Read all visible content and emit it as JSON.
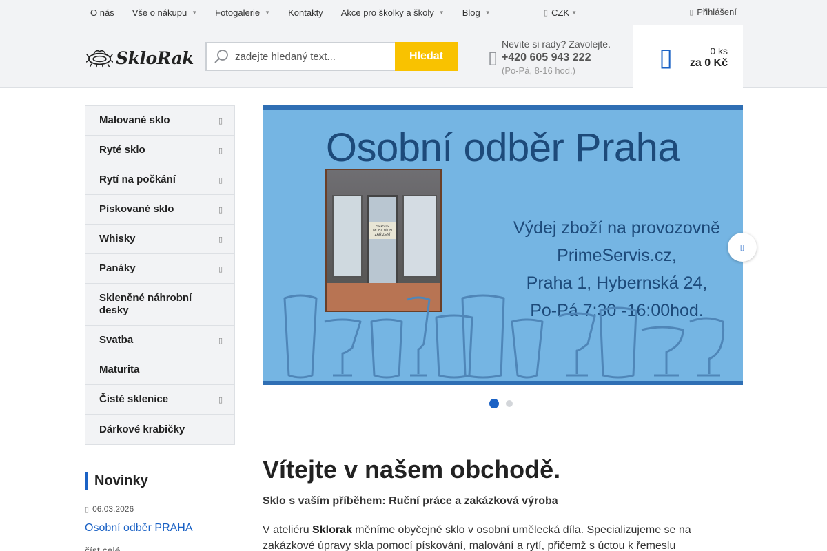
{
  "topnav": {
    "items": [
      {
        "label": "O nás",
        "has_dropdown": false
      },
      {
        "label": "Vše o nákupu",
        "has_dropdown": true
      },
      {
        "label": "Fotogalerie",
        "has_dropdown": true
      },
      {
        "label": "Kontakty",
        "has_dropdown": false
      },
      {
        "label": "Akce pro školky a školy",
        "has_dropdown": true
      },
      {
        "label": "Blog",
        "has_dropdown": true
      }
    ],
    "currency": "CZK",
    "login_label": "Přihlášení"
  },
  "header": {
    "logo_text": "SkloRak",
    "search_placeholder": "zadejte hledaný text...",
    "search_button": "Hledat",
    "contact_hint": "Nevíte si rady? Zavolejte.",
    "contact_phone": "+420 605 943 222",
    "contact_hours": "(Po-Pá, 8-16 hod.)",
    "cart_count": "0 ks",
    "cart_total": "za 0 Kč"
  },
  "categories": [
    {
      "label": "Malované sklo",
      "has_sub": true
    },
    {
      "label": "Ryté sklo",
      "has_sub": true
    },
    {
      "label": "Rytí na počkání",
      "has_sub": true
    },
    {
      "label": "Pískované sklo",
      "has_sub": true
    },
    {
      "label": "Whisky",
      "has_sub": true
    },
    {
      "label": "Panáky",
      "has_sub": true
    },
    {
      "label": "Skleněné náhrobní desky",
      "has_sub": false
    },
    {
      "label": "Svatba",
      "has_sub": true
    },
    {
      "label": "Maturita",
      "has_sub": false
    },
    {
      "label": "Čisté sklenice",
      "has_sub": true
    },
    {
      "label": "Dárkové krabičky",
      "has_sub": false
    }
  ],
  "banner": {
    "title": "Osobní odběr Praha",
    "lines": [
      "Výdej zboží na provozovně",
      "PrimeServis.cz,",
      "Praha 1, Hybernská 24,",
      "Po-Pá 7:30 -16:00hod."
    ],
    "photo_sign": "SERVIS MOBILNÍCH ZAŘÍZENÍ",
    "active_slide": 1,
    "slide_count": 2
  },
  "news": {
    "heading": "Novinky",
    "date": "06.03.2026",
    "title": "Osobní odběr PRAHA",
    "more": "číst celé"
  },
  "welcome": {
    "heading": "Vítejte v našem obchodě.",
    "subheading": "Sklo s vaším příběhem: Ruční práce a zakázková výroba",
    "para_prefix": "V ateliéru ",
    "para_brand": "Sklorak",
    "para_rest": " měníme obyčejné sklo v osobní umělecká díla. Specializujeme se na zakázkové úpravy skla pomocí pískování, malování a rytí, přičemž s úctou k řemeslu"
  },
  "colors": {
    "accent": "#1b62c5",
    "search_button": "#f9c200",
    "banner_bg": "#75b5e3",
    "banner_text": "#1d4a7a",
    "panel_bg": "#f2f3f5"
  },
  "icons": {
    "currency": "money-icon",
    "login": "user-icon",
    "search": "search-icon",
    "phone": "phone-icon",
    "cart": "cart-icon",
    "date": "calendar-icon",
    "slider_next": "chevron-right-icon",
    "category_arrow": "chevron-right-icon"
  }
}
